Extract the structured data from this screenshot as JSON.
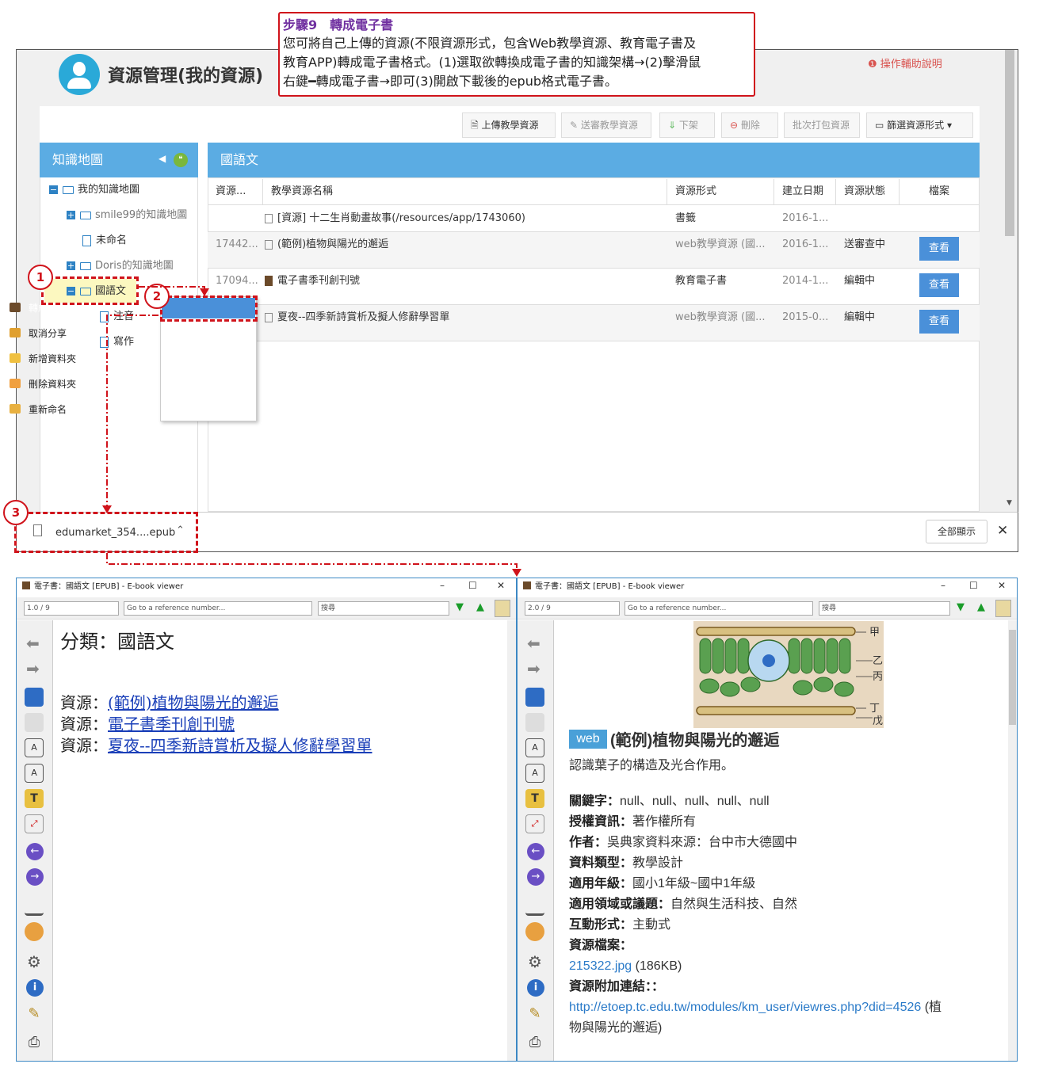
{
  "step": {
    "title": "步驟9　轉成電子書",
    "line1": "您可將自己上傳的資源(不限資源形式，包含Web教學資源、教育電子書及",
    "line2": "教育APP)轉成電子書格式。(1)選取欲轉換成電子書的知識架構→(2)擊滑鼠",
    "line3": "右鍵━轉成電子書→即可(3)開啟下載後的epub格式電子書。"
  },
  "header": {
    "title": "資源管理(我的資源)",
    "help": "操作輔助說明"
  },
  "toolbar": {
    "upload": "上傳教學資源",
    "submit": "送審教學資源",
    "remove": "下架",
    "delete": "刪除",
    "batch": "批次打包資源",
    "filter": "篩選資源形式"
  },
  "tree": {
    "heading": "知識地圖",
    "items": [
      "我的知識地圖",
      "smile99的知識地圖",
      "未命名",
      "Doris的知識地圖",
      "國語文",
      "注音",
      "寫作"
    ]
  },
  "context_menu": [
    "轉成電子書",
    "取消分享",
    "新增資料夾",
    "刪除資料夾",
    "重新命名"
  ],
  "table": {
    "heading": "國語文",
    "columns": [
      "資源...",
      "教學資源名稱",
      "資源形式",
      "建立日期",
      "資源狀態",
      "檔案"
    ],
    "rows": [
      {
        "id": "",
        "name": "[資源] 十二生肖動畫故事(/resources/app/1743060)",
        "type": "書籤",
        "date": "2016-1...",
        "status": "",
        "btn": ""
      },
      {
        "id": "17442...",
        "name": "(範例)植物與陽光的邂逅",
        "type": "web教學資源 (國...",
        "date": "2016-1...",
        "status": "送審查中",
        "btn": "查看"
      },
      {
        "id": "17094...",
        "name": "電子書季刊創刊號",
        "type": "教育電子書",
        "date": "2014-1...",
        "status": "編輯中",
        "btn": "查看"
      },
      {
        "id": "",
        "name": "夏夜--四季新詩賞析及擬人修辭學習單",
        "type": "web教學資源 (國...",
        "date": "2015-0...",
        "status": "編輯中",
        "btn": "查看"
      }
    ]
  },
  "download": {
    "file": "edumarket_354....epub",
    "show_all": "全部顯示"
  },
  "annotations": [
    "1",
    "2",
    "3"
  ],
  "viewer_left": {
    "title": "電子書：國語文 [EPUB] - E-book viewer",
    "page": "1.0 / 9",
    "goto_placeholder": "Go to a reference number...",
    "search": "搜尋",
    "heading": "分類：國語文",
    "links": [
      {
        "prefix": "資源：",
        "text": "(範例)植物與陽光的邂逅"
      },
      {
        "prefix": "資源：",
        "text": "電子書季刊創刊號"
      },
      {
        "prefix": "資源：",
        "text": "夏夜--四季新詩賞析及擬人修辭學習單"
      }
    ]
  },
  "viewer_right": {
    "title": "電子書：國語文 [EPUB] - E-book viewer",
    "page": "2.0 / 9",
    "goto_placeholder": "Go to a reference number...",
    "search": "搜尋",
    "figure_labels": [
      "甲",
      "乙",
      "丙",
      "丁",
      "戊"
    ],
    "badge": "web",
    "heading": "(範例)植物與陽光的邂逅",
    "summary": "認識葉子的構造及光合作用。",
    "fields": [
      {
        "k": "關鍵字：",
        "v": "null、null、null、null、null"
      },
      {
        "k": "授權資訊：",
        "v": "著作權所有"
      },
      {
        "k": "作者：",
        "v": "吳典家資料來源：台中市大德國中"
      },
      {
        "k": "資料類型：",
        "v": "教學設計"
      },
      {
        "k": "適用年級：",
        "v": "國小1年級~國中1年級"
      },
      {
        "k": "適用領域或議題：",
        "v": "自然與生活科技、自然"
      },
      {
        "k": "互動形式：",
        "v": "主動式"
      },
      {
        "k": "資源檔案：",
        "v": ""
      }
    ],
    "file_link": "215322.jpg",
    "file_size": "(186KB)",
    "attach_label": "資源附加連結：：",
    "attach_url": "http://etoep.tc.edu.tw/modules/km_user/viewres.php?did=4526",
    "attach_suffix1": " (植",
    "attach_suffix2": "物與陽光的邂逅)"
  }
}
